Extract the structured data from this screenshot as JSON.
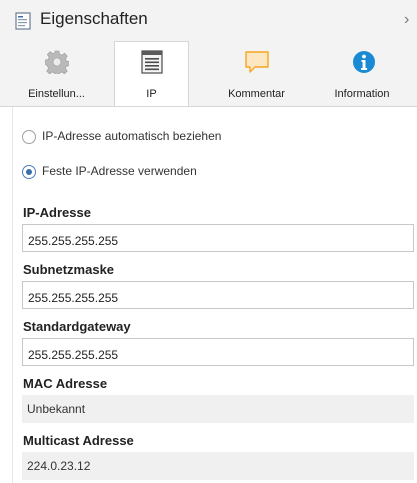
{
  "header": {
    "title": "Eigenschaften",
    "chevron": "›",
    "icon": "properties-document-icon"
  },
  "tabs": [
    {
      "label": "Einstellun...",
      "icon": "gear-icon",
      "active": false
    },
    {
      "label": "IP",
      "icon": "ip-list-icon",
      "active": true
    },
    {
      "label": "Kommentar",
      "icon": "comment-icon",
      "active": false
    },
    {
      "label": "Information",
      "icon": "info-icon",
      "active": false
    }
  ],
  "ip_mode": {
    "auto_label": "IP-Adresse automatisch beziehen",
    "fixed_label": "Feste IP-Adresse verwenden",
    "selected": "fixed"
  },
  "fields": {
    "ip": {
      "label": "IP-Adresse",
      "value": "255.255.255.255"
    },
    "subnet": {
      "label": "Subnetzmaske",
      "value": "255.255.255.255"
    },
    "gateway": {
      "label": "Standardgateway",
      "value": "255.255.255.255"
    },
    "mac": {
      "label": "MAC Adresse",
      "value": "Unbekannt"
    },
    "multicast": {
      "label": "Multicast Adresse",
      "value": "224.0.23.12"
    }
  },
  "colors": {
    "accent": "#3c6fa8",
    "comment_icon": "#f5a623",
    "info_icon": "#1a8ad4"
  }
}
